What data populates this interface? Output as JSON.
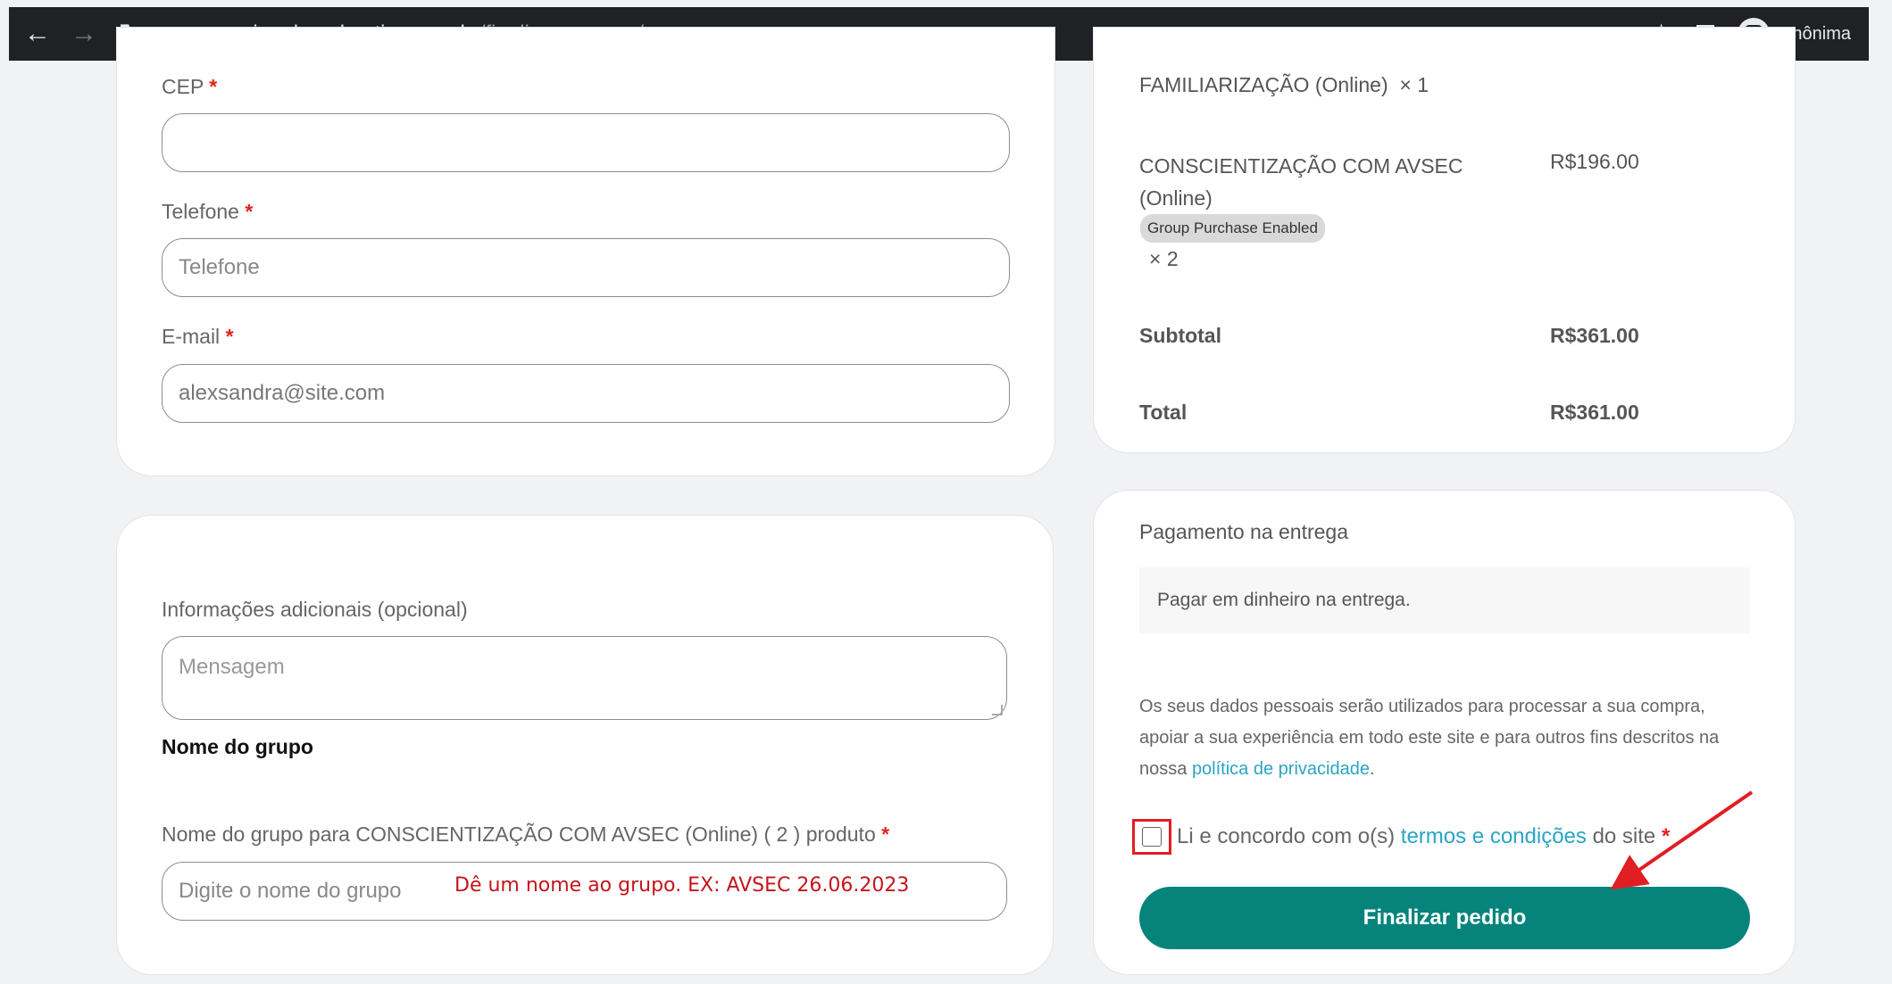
{
  "browser": {
    "url_host": "wp.riogaleao.kaptiva.com.br",
    "url_path": "/finalizar-compra/",
    "profile_label": "Anônima"
  },
  "billing": {
    "cep_label": "CEP",
    "cep_value": "",
    "phone_label": "Telefone",
    "phone_placeholder": "Telefone",
    "email_label": "E-mail",
    "email_value": "alexsandra@site.com",
    "required_mark": "*"
  },
  "additional": {
    "notes_label": "Informações adicionais (opcional)",
    "notes_placeholder": "Mensagem",
    "group_heading": "Nome do grupo",
    "group_field_label": "Nome do grupo para CONSCIENTIZAÇÃO COM AVSEC (Online) ( 2 ) produto",
    "group_placeholder": "Digite o nome do grupo",
    "group_hint": "Dê um nome ao grupo. EX: AVSEC 26.06.2023"
  },
  "order": {
    "item1_name": "FAMILIARIZAÇÃO (Online)",
    "item1_qty": "× 1",
    "item2_name_line1": "CONSCIENTIZAÇÃO COM AVSEC",
    "item2_name_line2": "(Online)",
    "item2_price": "R$196.00",
    "item2_badge": "Group Purchase Enabled",
    "item2_qty": "× 2",
    "subtotal_label": "Subtotal",
    "subtotal_value": "R$361.00",
    "total_label": "Total",
    "total_value": "R$361.00"
  },
  "payment": {
    "method_label": "Pagamento na entrega",
    "method_desc": "Pagar em dinheiro na entrega.",
    "privacy_line1": "Os seus dados pessoais serão utilizados para processar a sua compra,",
    "privacy_line2": "apoiar a sua experiência em todo este site e para outros fins descritos na",
    "privacy_line3_prefix": "nossa",
    "privacy_link": "política de privacidade",
    "privacy_line3_suffix": ".",
    "terms_prefix": "Li e concordo com o(s)",
    "terms_link": "termos e condições",
    "terms_suffix": "do site",
    "terms_checked": false,
    "submit_label": "Finalizar pedido",
    "accent_color": "#06847c",
    "annotation_color": "#e01e24"
  },
  "icons": {
    "back": "arrow-left-icon",
    "forward": "arrow-right-icon",
    "reload": "reload-icon",
    "lock": "lock-icon",
    "bookmark": "star-icon",
    "sidepanel": "side-panel-icon",
    "profile": "incognito-icon"
  }
}
